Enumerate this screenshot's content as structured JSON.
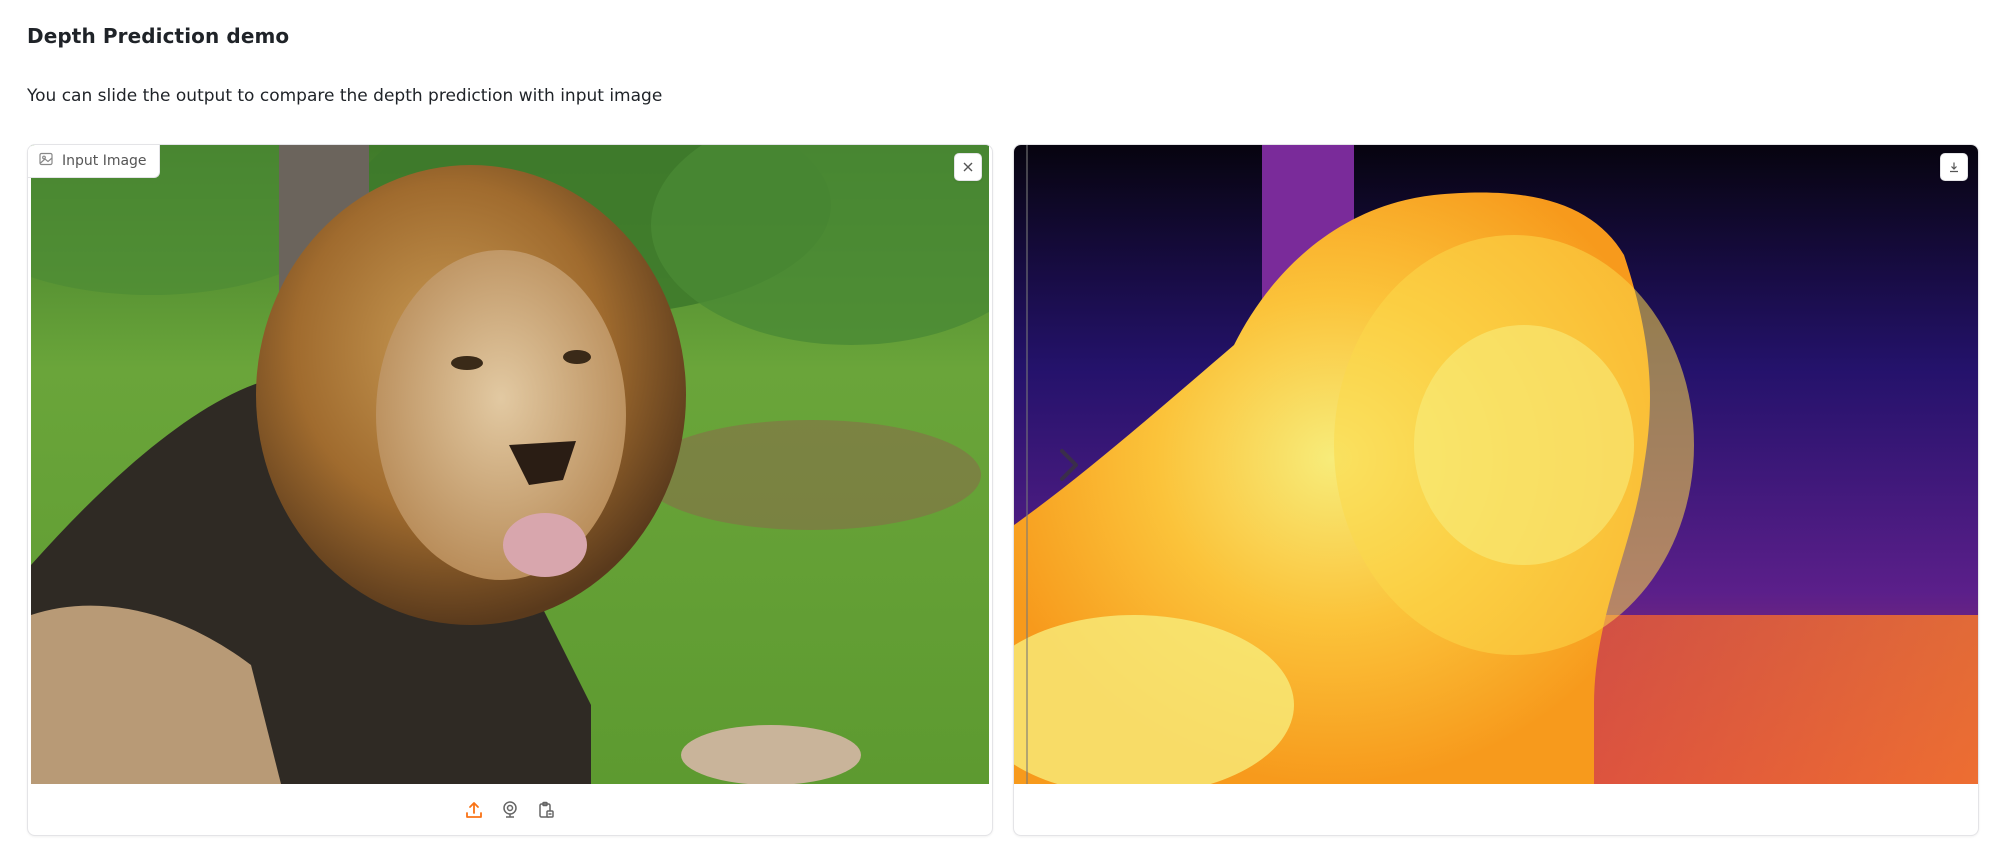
{
  "header": {
    "title": "Depth Prediction demo",
    "description": "You can slide the output to compare the depth prediction with input image"
  },
  "input_panel": {
    "label": "Input Image",
    "label_icon": "image-icon",
    "clear_icon": "close-icon",
    "toolbar": {
      "upload_icon": "upload-icon",
      "webcam_icon": "webcam-icon",
      "clipboard_icon": "clipboard-icon"
    }
  },
  "output_panel": {
    "download_icon": "download-icon",
    "slider_icon": "chevron-right-icon"
  },
  "colors": {
    "accent": "#f97316",
    "border": "#e4e4e7"
  }
}
